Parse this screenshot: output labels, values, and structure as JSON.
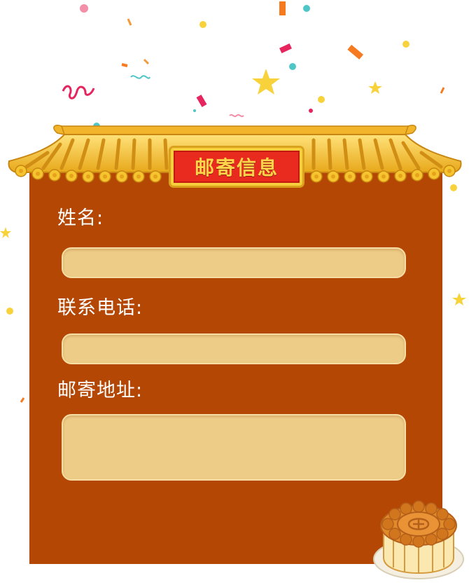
{
  "form": {
    "title": "邮寄信息",
    "name_label": "姓名:",
    "name_value": "",
    "phone_label": "联系电话:",
    "phone_value": "",
    "address_label": "邮寄地址:",
    "address_value": ""
  },
  "colors": {
    "board": "#b44704",
    "input_fill": "#edcc87",
    "plaque_red": "#e82a1f",
    "roof_gold": "#f5c02a",
    "label_text": "#ffffff"
  },
  "icons": {
    "roof": "palace-roof-icon",
    "mooncake": "mooncake-icon",
    "confetti": "confetti-decoration"
  }
}
